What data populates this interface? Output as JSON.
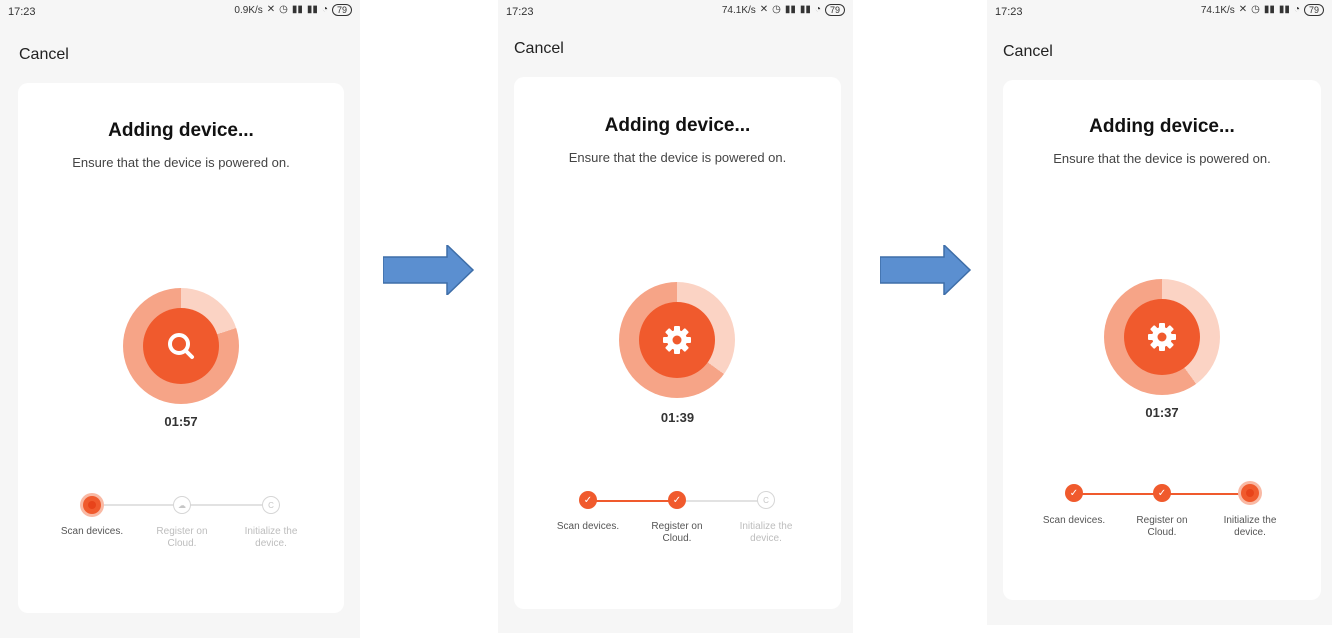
{
  "accent_color": "#f05a2d",
  "screens": [
    {
      "status": {
        "time": "17:23",
        "speed": "0.9K/s",
        "battery": "79"
      },
      "cancel_label": "Cancel",
      "title": "Adding device...",
      "subtitle": "Ensure that the device is powered on.",
      "icon": "search-icon",
      "timer": "01:57",
      "progress_fraction": 0.2,
      "steps": [
        {
          "label": "Scan devices.",
          "state": "active"
        },
        {
          "label": "Register on Cloud.",
          "state": "pending"
        },
        {
          "label": "Initialize the device.",
          "state": "pending"
        }
      ]
    },
    {
      "status": {
        "time": "17:23",
        "speed": "74.1K/s",
        "battery": "79"
      },
      "cancel_label": "Cancel",
      "title": "Adding device...",
      "subtitle": "Ensure that the device is powered on.",
      "icon": "gear-icon",
      "timer": "01:39",
      "progress_fraction": 0.35,
      "steps": [
        {
          "label": "Scan devices.",
          "state": "done"
        },
        {
          "label": "Register on Cloud.",
          "state": "done"
        },
        {
          "label": "Initialize the device.",
          "state": "pending"
        }
      ]
    },
    {
      "status": {
        "time": "17:23",
        "speed": "74.1K/s",
        "battery": "79"
      },
      "cancel_label": "Cancel",
      "title": "Adding device...",
      "subtitle": "Ensure that the device is powered on.",
      "icon": "gear-icon",
      "timer": "01:37",
      "progress_fraction": 0.4,
      "steps": [
        {
          "label": "Scan devices.",
          "state": "done"
        },
        {
          "label": "Register on Cloud.",
          "state": "done"
        },
        {
          "label": "Initialize the device.",
          "state": "active"
        }
      ]
    }
  ]
}
